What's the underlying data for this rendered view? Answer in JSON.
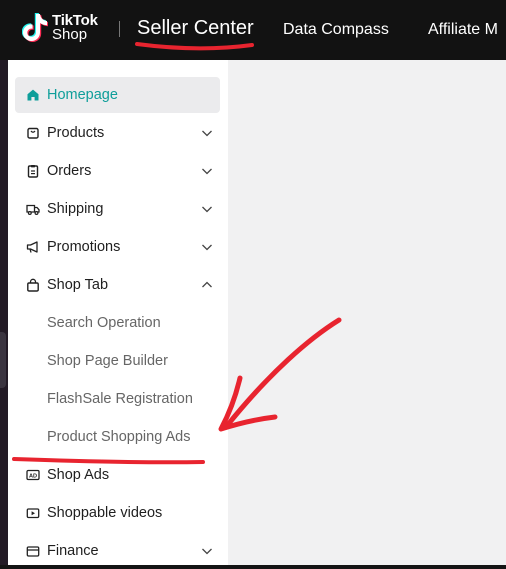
{
  "header": {
    "logo_line1": "TikTok",
    "logo_line2": "Shop",
    "title": "Seller Center",
    "nav": [
      "Data Compass",
      "Affiliate M"
    ]
  },
  "sidebar": {
    "items": [
      {
        "label": "Homepage",
        "icon": "home-icon",
        "active": true
      },
      {
        "label": "Products",
        "icon": "product-box-icon",
        "chevron": "down"
      },
      {
        "label": "Orders",
        "icon": "clipboard-icon",
        "chevron": "down"
      },
      {
        "label": "Shipping",
        "icon": "truck-icon",
        "chevron": "down"
      },
      {
        "label": "Promotions",
        "icon": "megaphone-icon",
        "chevron": "down"
      },
      {
        "label": "Shop Tab",
        "icon": "shopping-bag-icon",
        "chevron": "up"
      },
      {
        "label": "Shop Ads",
        "icon": "ad-icon"
      },
      {
        "label": "Shoppable videos",
        "icon": "video-icon"
      },
      {
        "label": "Finance",
        "icon": "wallet-icon",
        "chevron": "down"
      }
    ],
    "shop_tab_subitems": [
      "Search Operation",
      "Shop Page Builder",
      "FlashSale Registration",
      "Product Shopping Ads"
    ]
  },
  "colors": {
    "topbar": "#121212",
    "accent": "#0e9e9a",
    "annotation": "#e8242f",
    "sidebar_bg": "#ffffff",
    "content_bg": "#f1f1f2"
  }
}
